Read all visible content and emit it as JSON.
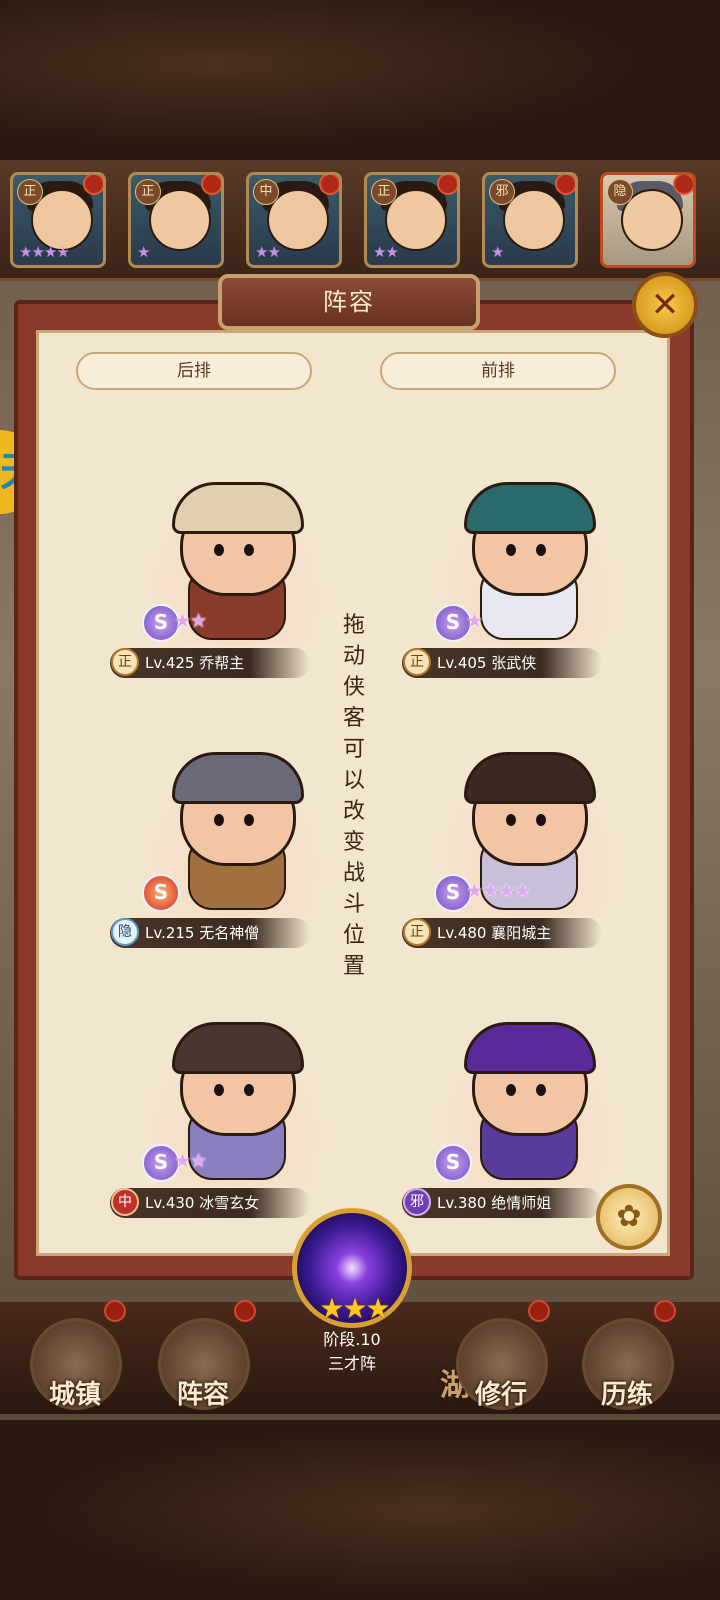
{
  "panel": {
    "title": "阵容",
    "back_row_label": "后排",
    "front_row_label": "前排",
    "hint": "拖动侠客可以改变战斗位置"
  },
  "hero_strip": [
    {
      "faction": "正",
      "stars": "★★★★"
    },
    {
      "faction": "正",
      "stars": "★"
    },
    {
      "faction": "中",
      "stars": "★★"
    },
    {
      "faction": "正",
      "stars": "★★"
    },
    {
      "faction": "邪",
      "stars": "★"
    },
    {
      "faction": "隐",
      "stars": ""
    }
  ],
  "lineup": {
    "back": [
      {
        "faction": "正",
        "name": "Lv.425 乔帮主",
        "stars": "★★",
        "rank": "S"
      },
      {
        "faction": "隐",
        "name": "Lv.215 无名神僧",
        "stars": "",
        "rank": "S"
      },
      {
        "faction": "中",
        "name": "Lv.430 冰雪玄女",
        "stars": "★★",
        "rank": "S"
      }
    ],
    "front": [
      {
        "faction": "正",
        "name": "Lv.405 张武侠",
        "stars": "★",
        "rank": "S"
      },
      {
        "faction": "正",
        "name": "Lv.480 襄阳城主",
        "stars": "★★★★",
        "rank": "S"
      },
      {
        "faction": "邪",
        "name": "Lv.380 绝情师姐",
        "stars": "",
        "rank": "S"
      }
    ]
  },
  "formation": {
    "stars": "★★★",
    "stage": "阶段.10",
    "name": "三才阵"
  },
  "nav": {
    "town": "城镇",
    "lineup": "阵容",
    "jianghu": "湖",
    "cultivate": "修行",
    "trial": "历练"
  },
  "side_tag": "天",
  "icons": {
    "close": "close-icon",
    "petal": "flower-icon",
    "formation": "magic-circle-icon"
  },
  "colors": {
    "panel_bg": "#f3e6cf",
    "frame": "#8a3a2a",
    "gold": "#d8a030",
    "star_purple": "#e2a6f0"
  }
}
